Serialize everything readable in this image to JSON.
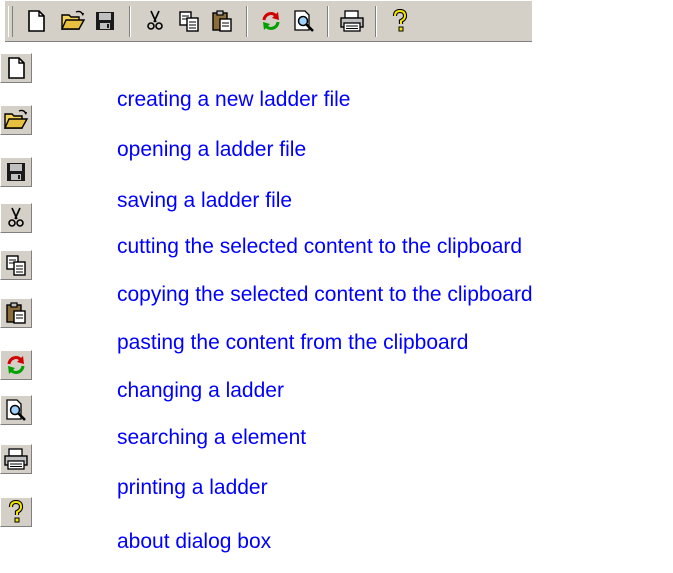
{
  "toolbar": {
    "buttons": [
      {
        "icon": "new-file-icon"
      },
      {
        "icon": "open-folder-icon"
      },
      {
        "icon": "save-disk-icon"
      },
      {
        "icon": "cut-scissors-icon"
      },
      {
        "icon": "copy-icon"
      },
      {
        "icon": "paste-clipboard-icon"
      },
      {
        "icon": "change-arrows-icon"
      },
      {
        "icon": "search-magnifier-icon"
      },
      {
        "icon": "print-printer-icon"
      },
      {
        "icon": "help-question-icon"
      }
    ]
  },
  "legend": {
    "items": [
      {
        "icon": "new-file-icon",
        "label": "creating a new ladder file"
      },
      {
        "icon": "open-folder-icon",
        "label": "opening a ladder file"
      },
      {
        "icon": "save-disk-icon",
        "label": "saving a ladder file"
      },
      {
        "icon": "cut-scissors-icon",
        "label": "cutting the selected content to the clipboard"
      },
      {
        "icon": "copy-icon",
        "label": "copying the selected content to the clipboard"
      },
      {
        "icon": "paste-clipboard-icon",
        "label": "pasting the content from the clipboard"
      },
      {
        "icon": "change-arrows-icon",
        "label": "changing a ladder"
      },
      {
        "icon": "search-magnifier-icon",
        "label": "searching a element"
      },
      {
        "icon": "print-printer-icon",
        "label": "printing a ladder"
      },
      {
        "icon": "help-question-icon",
        "label": "about dialog box"
      }
    ]
  },
  "colors": {
    "link": "#0000ff",
    "face": "#d4d0c8",
    "highlight": "#ffffff",
    "shadow": "#808080"
  }
}
